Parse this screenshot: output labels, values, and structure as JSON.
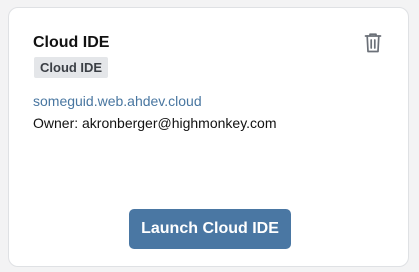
{
  "card": {
    "title": "Cloud IDE",
    "badge": "Cloud IDE",
    "host_link": "someguid.web.ahdev.cloud",
    "owner_text": "Owner: akronberger@highmonkey.com",
    "delete_icon": "trash-icon",
    "launch_label": "Launch Cloud IDE"
  },
  "colors": {
    "accent": "#4a77a3",
    "link": "#4876a0",
    "badge_bg": "#e4e6e9"
  }
}
